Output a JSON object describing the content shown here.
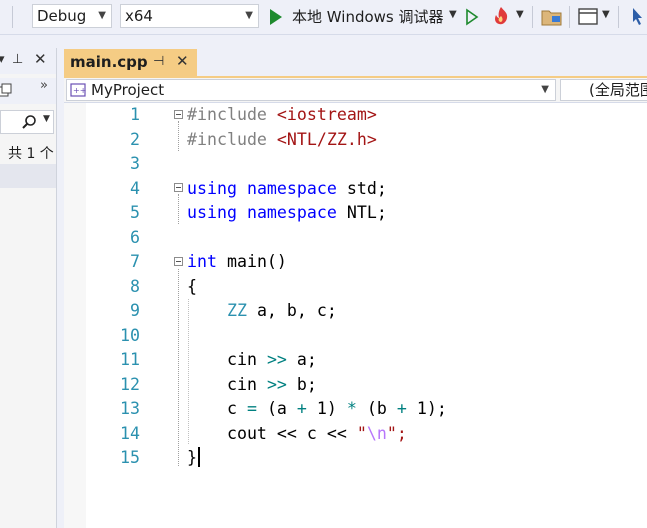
{
  "toolbar": {
    "config": "Debug",
    "platform": "x64",
    "debugger_label": "本地 Windows 调试器",
    "icons": [
      "start-debug-icon",
      "start-without-debug-icon",
      "hot-reload-icon",
      "solution-explorer-icon",
      "window-layout-icon",
      "more-icon"
    ]
  },
  "left_panel": {
    "result_text": "共 1 个"
  },
  "editor": {
    "tab_title": "main.cpp",
    "project": "MyProject",
    "scope": "(全局范围"
  },
  "code": {
    "lines": [
      {
        "n": "1",
        "segs": [
          {
            "t": "#include ",
            "c": "pp"
          },
          {
            "t": "<iostream>",
            "c": "str"
          }
        ]
      },
      {
        "n": "2",
        "segs": [
          {
            "t": "#include ",
            "c": "pp"
          },
          {
            "t": "<NTL/ZZ.h>",
            "c": "str"
          }
        ]
      },
      {
        "n": "3",
        "segs": []
      },
      {
        "n": "4",
        "segs": [
          {
            "t": "using",
            "c": "kw"
          },
          {
            "t": " ",
            "c": ""
          },
          {
            "t": "namespace",
            "c": "kw"
          },
          {
            "t": " std;",
            "c": ""
          }
        ]
      },
      {
        "n": "5",
        "segs": [
          {
            "t": "using",
            "c": "kw"
          },
          {
            "t": " ",
            "c": ""
          },
          {
            "t": "namespace",
            "c": "kw"
          },
          {
            "t": " NTL;",
            "c": ""
          }
        ]
      },
      {
        "n": "6",
        "segs": []
      },
      {
        "n": "7",
        "segs": [
          {
            "t": "int",
            "c": "kw"
          },
          {
            "t": " main()",
            "c": ""
          }
        ]
      },
      {
        "n": "8",
        "segs": [
          {
            "t": "{",
            "c": ""
          }
        ]
      },
      {
        "n": "9",
        "segs": [
          {
            "t": "    ",
            "c": ""
          },
          {
            "t": "ZZ",
            "c": "ty"
          },
          {
            "t": " a, b, c;",
            "c": ""
          }
        ]
      },
      {
        "n": "10",
        "segs": []
      },
      {
        "n": "11",
        "segs": [
          {
            "t": "    cin ",
            "c": ""
          },
          {
            "t": ">>",
            "c": "op"
          },
          {
            "t": " a;",
            "c": ""
          }
        ]
      },
      {
        "n": "12",
        "segs": [
          {
            "t": "    cin ",
            "c": ""
          },
          {
            "t": ">>",
            "c": "op"
          },
          {
            "t": " b;",
            "c": ""
          }
        ]
      },
      {
        "n": "13",
        "segs": [
          {
            "t": "    c ",
            "c": ""
          },
          {
            "t": "=",
            "c": "op"
          },
          {
            "t": " (a ",
            "c": ""
          },
          {
            "t": "+",
            "c": "op"
          },
          {
            "t": " 1) ",
            "c": ""
          },
          {
            "t": "*",
            "c": "op"
          },
          {
            "t": " (b ",
            "c": ""
          },
          {
            "t": "+",
            "c": "op"
          },
          {
            "t": " 1);",
            "c": ""
          }
        ]
      },
      {
        "n": "14",
        "segs": [
          {
            "t": "    cout << c << ",
            "c": ""
          },
          {
            "t": "\"",
            "c": "str"
          },
          {
            "t": "\\n",
            "c": "esc"
          },
          {
            "t": "\";",
            "c": "str"
          }
        ]
      },
      {
        "n": "15",
        "segs": [
          {
            "t": "}",
            "c": ""
          }
        ]
      }
    ]
  }
}
